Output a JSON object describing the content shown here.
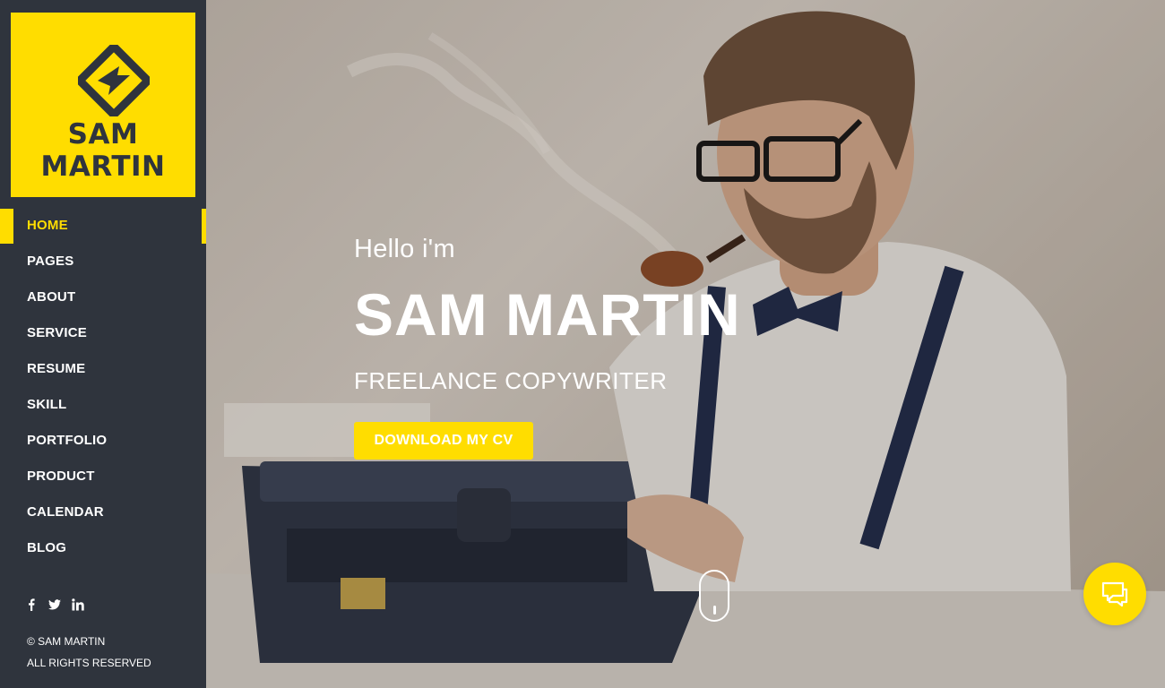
{
  "brand": {
    "line1": "SAM",
    "line2": "MARTIN",
    "accent_color": "#ffdd00",
    "sidebar_color": "#2f343d",
    "logo_icon": "diamond-s-logo-icon"
  },
  "nav": {
    "items": [
      {
        "label": "HOME",
        "active": true
      },
      {
        "label": "PAGES"
      },
      {
        "label": "ABOUT"
      },
      {
        "label": "SERVICE"
      },
      {
        "label": "RESUME"
      },
      {
        "label": "SKILL"
      },
      {
        "label": "PORTFOLIO"
      },
      {
        "label": "PRODUCT"
      },
      {
        "label": "CALENDAR"
      },
      {
        "label": "BLOG"
      }
    ]
  },
  "social": {
    "icons": [
      "facebook-icon",
      "twitter-icon",
      "linkedin-icon"
    ]
  },
  "footer": {
    "copyright": "© SAM MARTIN",
    "rights": "ALL RIGHTS RESERVED"
  },
  "hero": {
    "greeting": "Hello i'm",
    "name": "SAM MARTIN",
    "role": "FREELANCE COPYWRITER",
    "cta_label": "DOWNLOAD MY CV"
  },
  "widgets": {
    "scroll_icon": "mouse-scroll-icon",
    "chat_icon": "chat-bubble-icon"
  }
}
